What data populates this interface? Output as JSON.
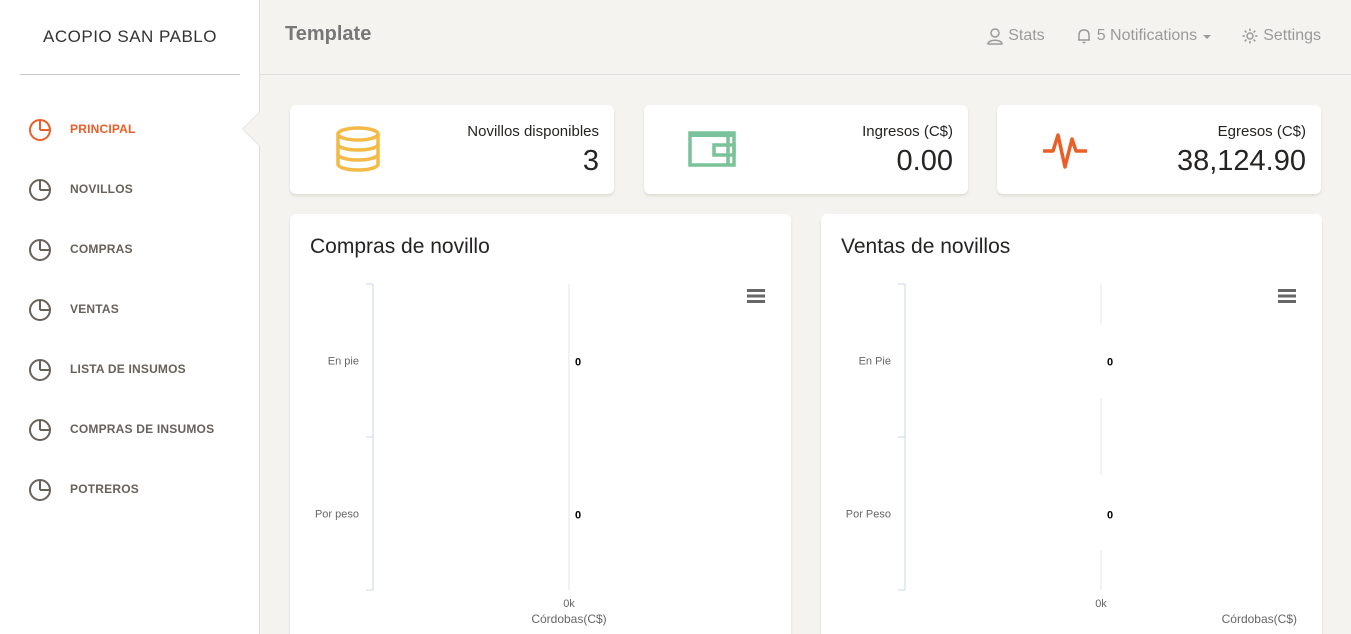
{
  "sidebar": {
    "brand": "ACOPIO SAN PABLO",
    "items": [
      {
        "label": "PRINCIPAL",
        "active": true
      },
      {
        "label": "NOVILLOS",
        "active": false
      },
      {
        "label": "COMPRAS",
        "active": false
      },
      {
        "label": "VENTAS",
        "active": false
      },
      {
        "label": "LISTA DE INSUMOS",
        "active": false
      },
      {
        "label": "COMPRAS DE INSUMOS",
        "active": false
      },
      {
        "label": "POTREROS",
        "active": false
      }
    ]
  },
  "header": {
    "title": "Template",
    "stats": "Stats",
    "notifications": "5 Notifications",
    "settings": "Settings"
  },
  "stats": [
    {
      "label": "Novillos disponibles",
      "value": "3",
      "icon": "database-icon",
      "color": "#f3bb45"
    },
    {
      "label": "Ingresos (C$)",
      "value": "0.00",
      "icon": "wallet-icon",
      "color": "#7ac29a"
    },
    {
      "label": "Egresos (C$)",
      "value": "38,124.90",
      "icon": "pulse-icon",
      "color": "#eb5e28"
    }
  ],
  "colors": {
    "accent": "#eb5e28",
    "background": "#f4f3ef"
  },
  "chart_data": [
    {
      "type": "bar",
      "title": "Compras de novillo",
      "categories": [
        "En pie",
        "Por peso"
      ],
      "values": [
        0,
        0
      ],
      "data_labels": [
        "0",
        "0"
      ],
      "x_tick_labels": [
        "0k"
      ],
      "ylabel": "Córdobas(C$)",
      "orientation": "horizontal",
      "legend": "none"
    },
    {
      "type": "bar",
      "title": "Ventas de novillos",
      "categories": [
        "En Pie",
        "Por Peso"
      ],
      "values": [
        0,
        0
      ],
      "data_labels": [
        "0",
        "0"
      ],
      "x_tick_labels": [
        "0k"
      ],
      "ylabel": "Córdobas(C$)",
      "orientation": "horizontal",
      "legend": "none"
    }
  ]
}
